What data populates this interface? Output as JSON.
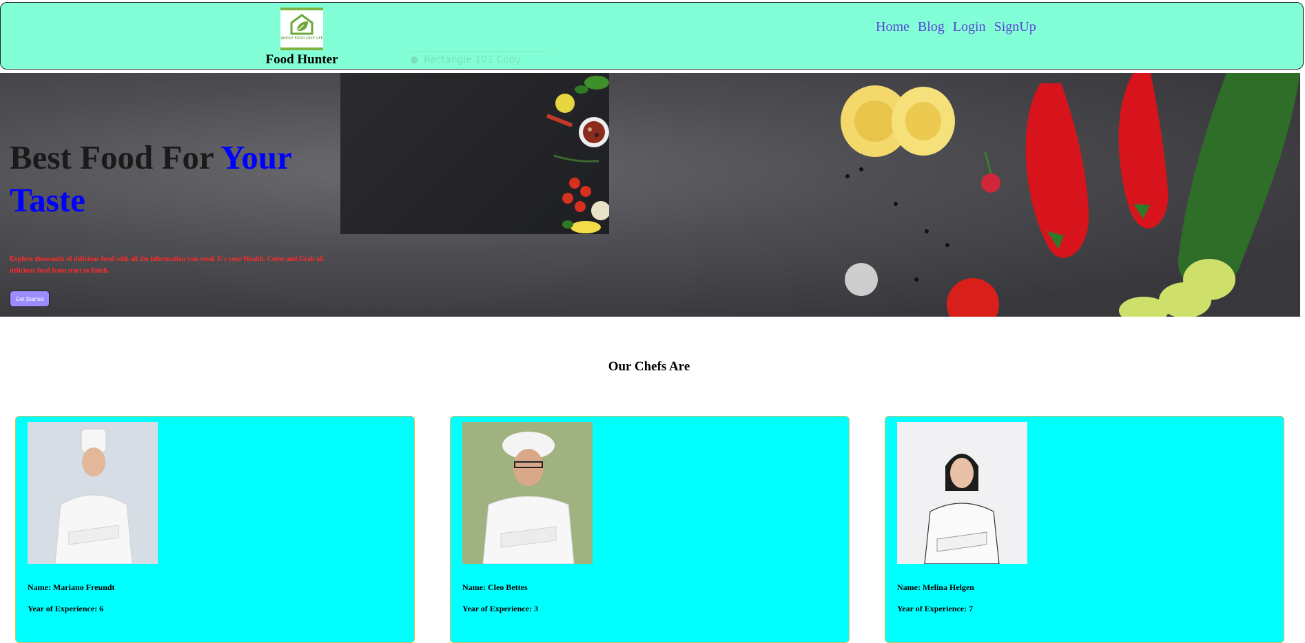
{
  "header": {
    "logo_caption": "WHOLE FOOD LOVE LIFE",
    "brand": "Food Hunter",
    "nav": [
      "Home",
      "Blog",
      "Login",
      "SignUp"
    ],
    "ghost_search": "Rectangle 101 Copy",
    "bg_color": "#82ffd6"
  },
  "hero": {
    "title_part1": "Best Food For ",
    "title_accent": "Your Taste",
    "description": "Explore thousands of delicious food with all the information you need. It's your Health. Come and Grab all delicious food from start to finish.",
    "button_label": "Get Started",
    "accent_color": "#0000ff",
    "description_color": "#ff2a2a"
  },
  "chefs_section": {
    "title": "Our Chefs Are",
    "chefs": [
      {
        "name_label": "Name: Mariano Freundt",
        "exp_label": "Year of Experience: 6"
      },
      {
        "name_label": "Name: Cleo Bettes",
        "exp_label": "Year of Experience: 3"
      },
      {
        "name_label": "Name: Melina Helgen",
        "exp_label": "Year of Experience: 7"
      }
    ],
    "card_color": "#00ffff"
  }
}
